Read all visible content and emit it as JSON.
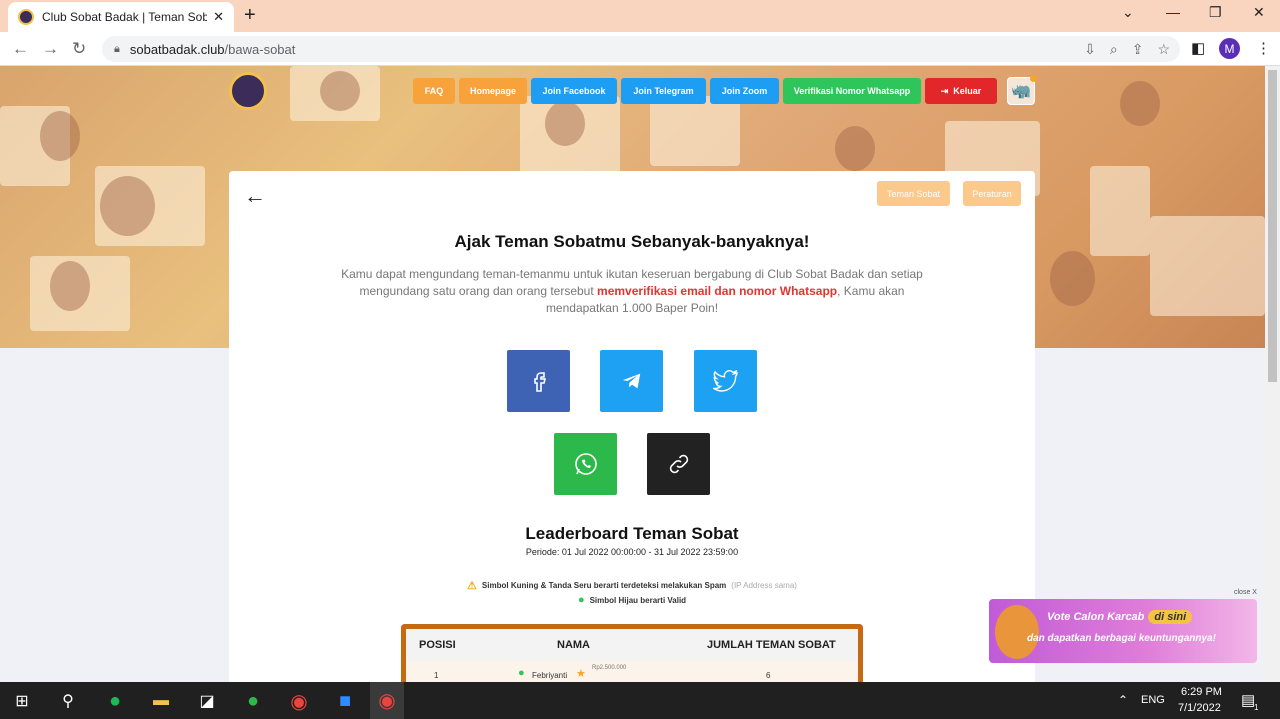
{
  "browser": {
    "tab_title": "Club Sobat Badak | Teman Sobat",
    "url_host": "sobatbadak.club",
    "url_path": "/bawa-sobat",
    "profile_initial": "M"
  },
  "nav": {
    "faq": "FAQ",
    "homepage": "Homepage",
    "join_facebook": "Join Facebook",
    "join_telegram": "Join Telegram",
    "join_zoom": "Join Zoom",
    "verify_whatsapp": "Verifikasi Nomor Whatsapp",
    "logout": "Keluar"
  },
  "colors": {
    "faq": "#f7a23b",
    "homepage": "#f7a23b",
    "blue": "#1e9ef3",
    "green": "#2ec55b",
    "red": "#e3262a",
    "facebook": "#3e63b5",
    "telegram": "#1ea1f2",
    "twitter": "#1da1f2",
    "whatsapp": "#2db84c",
    "link": "#222222"
  },
  "card": {
    "teman_sobat": "Teman Sobat",
    "peraturan": "Peraturan",
    "heading": "Ajak Teman Sobatmu Sebanyak-banyaknya!",
    "desc_part1": "Kamu dapat mengundang teman-temanmu untuk ikutan keseruan bergabung di Club Sobat Badak dan setiap mengundang satu orang dan orang tersebut ",
    "desc_highlight": "memverifikasi email dan nomor Whatsapp",
    "desc_part2": ", Kamu akan mendapatkan 1.000 Baper Poin!"
  },
  "share_icons": [
    "facebook-icon",
    "telegram-icon",
    "twitter-icon",
    "whatsapp-icon",
    "link-icon"
  ],
  "leaderboard": {
    "title": "Leaderboard Teman Sobat",
    "period": "Periode: 01 Jul 2022 00:00:00 - 31 Jul 2022 23:59:00",
    "note_spam": "Simbol Kuning & Tanda Seru berarti terdeteksi melakukan Spam",
    "note_spam_muted": "(IP Address sama)",
    "note_valid": "Simbol Hijau berarti Valid",
    "headers": [
      "POSISI",
      "NAMA",
      "JUMLAH TEMAN SOBAT"
    ],
    "rows": [
      {
        "pos": "1",
        "name": "Febriyanti",
        "badge": "Rp2.500.000",
        "count": "6"
      }
    ]
  },
  "ad": {
    "close": "close X",
    "line1": "Vote Calon Karcab",
    "pill": "di sini",
    "line2": "dan dapatkan berbagai keuntungannya!"
  },
  "taskbar": {
    "lang": "ENG",
    "time": "6:29 PM",
    "date": "7/1/2022",
    "notif": "1"
  }
}
